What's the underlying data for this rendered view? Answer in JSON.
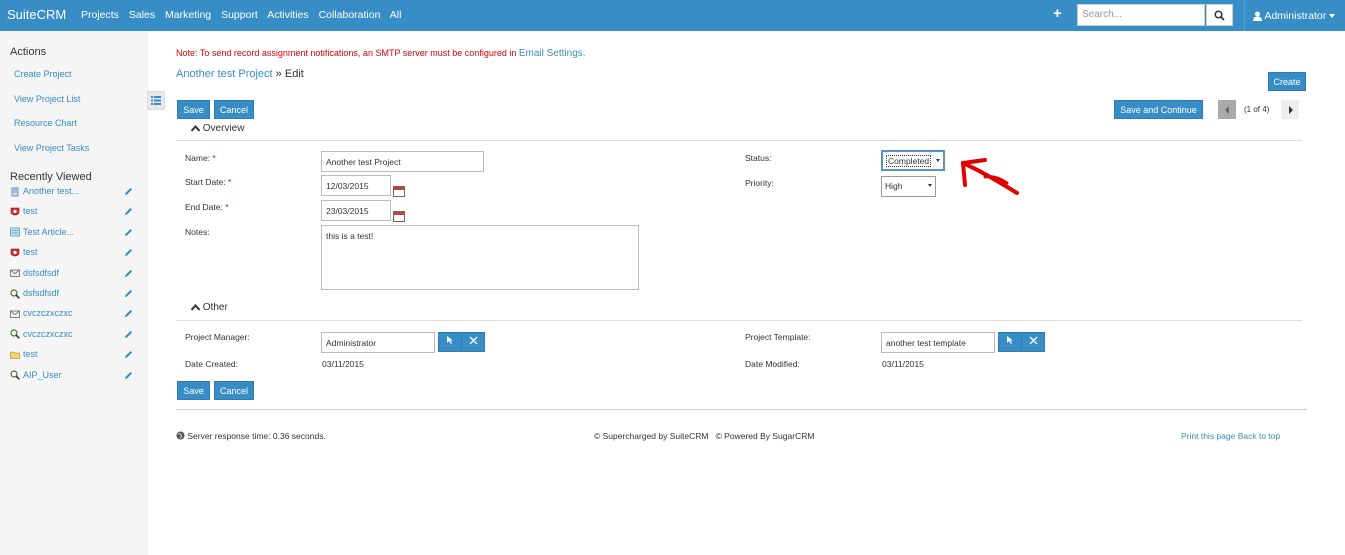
{
  "topbar": {
    "brand": "SuiteCRM",
    "nav": [
      "Projects",
      "Sales",
      "Marketing",
      "Support",
      "Activities",
      "Collaboration",
      "All"
    ],
    "search_placeholder": "Search...",
    "user": "Administrator"
  },
  "sidebar": {
    "actions_title": "Actions",
    "actions": [
      "Create Project",
      "View Project List",
      "Resource Chart",
      "View Project Tasks"
    ],
    "recent_title": "Recently Viewed",
    "recent": [
      {
        "label": "Another test...",
        "icon": "project-icon"
      },
      {
        "label": "test",
        "icon": "bug-icon"
      },
      {
        "label": "Test Article...",
        "icon": "article-icon"
      },
      {
        "label": "test",
        "icon": "bug-icon"
      },
      {
        "label": "dsfsdfsdf",
        "icon": "email-icon"
      },
      {
        "label": "dsfsdfsdf",
        "icon": "search-icon"
      },
      {
        "label": "cvczczxczxc",
        "icon": "email-icon"
      },
      {
        "label": "cvczczxczxc",
        "icon": "search-icon"
      },
      {
        "label": "test",
        "icon": "folder-icon"
      },
      {
        "label": "AIP_User",
        "icon": "search-icon"
      }
    ]
  },
  "notice": {
    "text": "Note: To send record assignment notifications, an SMTP server must be configured in",
    "link": "Email Settings."
  },
  "breadcrumb": {
    "record": "Another test Project",
    "sep": "»",
    "mode": "Edit"
  },
  "buttons": {
    "create": "Create",
    "save": "Save",
    "cancel": "Cancel",
    "save_continue": "Save and Continue",
    "pager": "(1 of 4)"
  },
  "overview": {
    "title": "Overview",
    "name_label": "Name:",
    "name_value": "Another test Project",
    "start_label": "Start Date:",
    "start_value": "12/03/2015",
    "end_label": "End Date:",
    "end_value": "23/03/2015",
    "notes_label": "Notes:",
    "notes_value": "this is a test!",
    "status_label": "Status:",
    "status_value": "Completed",
    "priority_label": "Priority:",
    "priority_value": "High",
    "required_mark": "*"
  },
  "other": {
    "title": "Other",
    "manager_label": "Project Manager:",
    "manager_value": "Administrator",
    "template_label": "Project Template:",
    "template_value": "another test template",
    "created_label": "Date Created:",
    "created_value": "03/11/2015",
    "modified_label": "Date Modified:",
    "modified_value": "03/11/2015"
  },
  "footer": {
    "response": "Server response time: 0.36 seconds.",
    "supercharged": "© Supercharged by SuiteCRM",
    "powered": "© Powered By SugarCRM",
    "print": "Print this page",
    "back": "Back to top"
  },
  "colors": {
    "brand": "#378dc6",
    "required": "#dd0000",
    "annotation": "#e00000"
  }
}
